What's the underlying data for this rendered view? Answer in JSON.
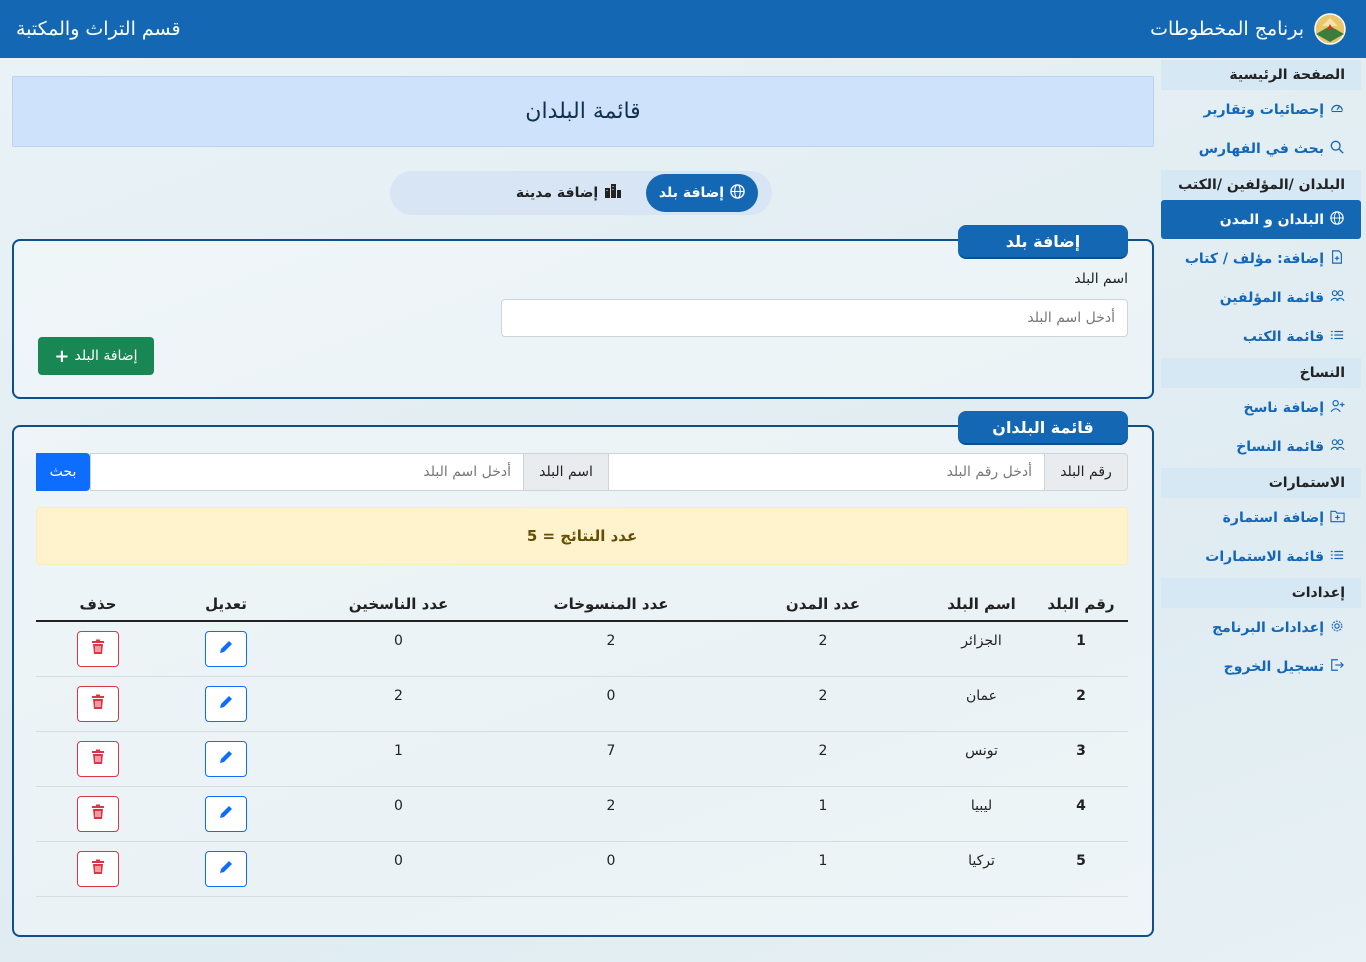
{
  "header": {
    "app_title": "برنامج المخطوطات",
    "department": "قسم التراث والمكتبة"
  },
  "sidebar": {
    "items": [
      {
        "type": "head",
        "label": "الصفحة الرئيسية"
      },
      {
        "type": "item",
        "label": "إحصائيات وتقارير",
        "icon": "gauge-icon"
      },
      {
        "type": "item",
        "label": "بحث في الفهارس",
        "icon": "search-icon"
      },
      {
        "type": "head",
        "label": "البلدان /المؤلفين /الكتب"
      },
      {
        "type": "item",
        "label": "البلدان و المدن",
        "icon": "globe-icon",
        "active": true
      },
      {
        "type": "item",
        "label": "إضافة: مؤلف / كتاب",
        "icon": "file-plus-icon"
      },
      {
        "type": "item",
        "label": "قائمة المؤلفين",
        "icon": "people-icon"
      },
      {
        "type": "item",
        "label": "قائمة الكتب",
        "icon": "list-icon"
      },
      {
        "type": "head",
        "label": "النساخ"
      },
      {
        "type": "item",
        "label": "إضافة ناسخ",
        "icon": "person-plus-icon"
      },
      {
        "type": "item",
        "label": "قائمة النساخ",
        "icon": "people-icon"
      },
      {
        "type": "head",
        "label": "الاستمارات"
      },
      {
        "type": "item",
        "label": "إضافة استمارة",
        "icon": "folder-plus-icon"
      },
      {
        "type": "item",
        "label": "قائمة الاستمارات",
        "icon": "list-icon"
      },
      {
        "type": "head",
        "label": "إعدادات"
      },
      {
        "type": "item",
        "label": "إعدادات البرنامج",
        "icon": "gear-icon"
      },
      {
        "type": "item",
        "label": "تسجيل الخروج",
        "icon": "logout-icon"
      }
    ]
  },
  "page": {
    "title": "قائمة البلدان",
    "toggle": {
      "add_country": "إضافة بلد",
      "add_city": "إضافة مدينة"
    }
  },
  "add_card": {
    "tab": "إضافة بلد",
    "label": "اسم البلد",
    "placeholder": "أدخل اسم البلد",
    "button": "إضافة البلد"
  },
  "list_card": {
    "tab": "قائمة البلدان",
    "num_label": "رقم البلد",
    "num_placeholder": "أدخل رقم البلد",
    "name_label": "اسم البلد",
    "name_placeholder": "أدخل اسم البلد",
    "search_button": "بحث",
    "results": "عدد النتائج = 5",
    "columns": [
      "رقم البلد",
      "اسم البلد",
      "عدد المدن",
      "عدد المنسوخات",
      "عدد الناسخين",
      "تعديل",
      "حذف"
    ],
    "rows": [
      [
        "1",
        "الجزائر",
        "2",
        "2",
        "0"
      ],
      [
        "2",
        "عمان",
        "2",
        "0",
        "2"
      ],
      [
        "3",
        "تونس",
        "2",
        "7",
        "1"
      ],
      [
        "4",
        "ليبيا",
        "1",
        "2",
        "0"
      ],
      [
        "5",
        "تركيا",
        "1",
        "0",
        "0"
      ]
    ]
  }
}
